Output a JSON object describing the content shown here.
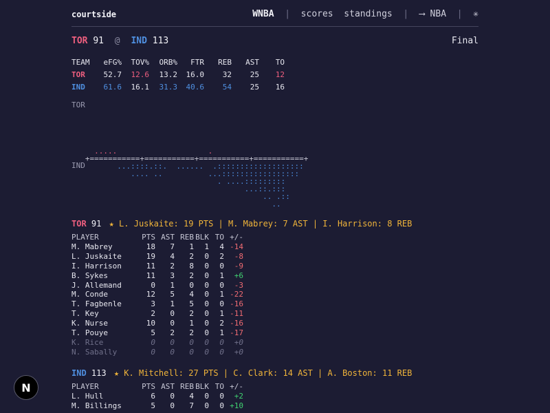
{
  "brand": "courtside",
  "nav": {
    "league": "WNBA",
    "sep": "|",
    "scores": "scores",
    "standings": "standings",
    "nba": "⟶ NBA",
    "theme_icon": "✳"
  },
  "game": {
    "away_abbr": "TOR",
    "away_score": "91",
    "at": "@",
    "home_abbr": "IND",
    "home_score": "113",
    "status": "Final"
  },
  "four_factors": {
    "headers": [
      "TEAM",
      "eFG%",
      "TOV%",
      "ORB%",
      "FTR",
      "REB",
      "AST",
      "TO"
    ],
    "rows": [
      {
        "team": "TOR",
        "values": [
          "52.7",
          "12.6",
          "13.2",
          "16.0",
          "32",
          "25",
          "12"
        ]
      },
      {
        "team": "IND",
        "values": [
          "61.6",
          "16.1",
          "31.3",
          "40.6",
          "54",
          "25",
          "16"
        ]
      }
    ]
  },
  "flow": {
    "top_label": "TOR",
    "bottom_label": "IND",
    "tor_line": "     .....                    .",
    "axis": "   +===========+===========+===========+===========+",
    "ind_lines": [
      "          ...::::.::.  ......  .:::::::::::::::::::",
      "             .... ..          ...:::::::::::::::::",
      "                                . ....:::::::::",
      "                                      ...::.:::",
      "                                          .. .::",
      "                                            .."
    ]
  },
  "box_headers": [
    "PLAYER",
    "PTS",
    "AST",
    "REB",
    "BLK",
    "TO",
    "+/-"
  ],
  "tor_box": {
    "abbr": "TOR",
    "score": "91",
    "leaders": "★ L. Juskaite: 19 PTS | M. Mabrey: 7 AST | I. Harrison: 8 REB",
    "players": [
      {
        "name": "M. Mabrey",
        "pts": "18",
        "ast": "7",
        "reb": "1",
        "blk": "1",
        "to": "4",
        "pm": "-14"
      },
      {
        "name": "L. Juskaite",
        "pts": "19",
        "ast": "4",
        "reb": "2",
        "blk": "0",
        "to": "2",
        "pm": "-8"
      },
      {
        "name": "I. Harrison",
        "pts": "11",
        "ast": "2",
        "reb": "8",
        "blk": "0",
        "to": "0",
        "pm": "-9"
      },
      {
        "name": "B. Sykes",
        "pts": "11",
        "ast": "3",
        "reb": "2",
        "blk": "0",
        "to": "1",
        "pm": "+6"
      },
      {
        "name": "J. Allemand",
        "pts": "0",
        "ast": "1",
        "reb": "0",
        "blk": "0",
        "to": "0",
        "pm": "-3"
      },
      {
        "name": "M. Conde",
        "pts": "12",
        "ast": "5",
        "reb": "4",
        "blk": "0",
        "to": "1",
        "pm": "-22"
      },
      {
        "name": "T. Fagbenle",
        "pts": "3",
        "ast": "1",
        "reb": "5",
        "blk": "0",
        "to": "0",
        "pm": "-16"
      },
      {
        "name": "T. Key",
        "pts": "2",
        "ast": "0",
        "reb": "2",
        "blk": "0",
        "to": "1",
        "pm": "-11"
      },
      {
        "name": "K. Nurse",
        "pts": "10",
        "ast": "0",
        "reb": "1",
        "blk": "0",
        "to": "2",
        "pm": "-16"
      },
      {
        "name": "T. Pouye",
        "pts": "5",
        "ast": "2",
        "reb": "2",
        "blk": "0",
        "to": "1",
        "pm": "-17"
      },
      {
        "name": "K. Rice",
        "pts": "0",
        "ast": "0",
        "reb": "0",
        "blk": "0",
        "to": "0",
        "pm": "+0",
        "dnp": true
      },
      {
        "name": "N. Sabally",
        "pts": "0",
        "ast": "0",
        "reb": "0",
        "blk": "0",
        "to": "0",
        "pm": "+0",
        "dnp": true
      }
    ]
  },
  "ind_box": {
    "abbr": "IND",
    "score": "113",
    "leaders": "★ K. Mitchell: 27 PTS | C. Clark: 14 AST | A. Boston: 11 REB",
    "players": [
      {
        "name": "L. Hull",
        "pts": "6",
        "ast": "0",
        "reb": "4",
        "blk": "0",
        "to": "0",
        "pm": "+2"
      },
      {
        "name": "M. Billings",
        "pts": "5",
        "ast": "0",
        "reb": "7",
        "blk": "0",
        "to": "0",
        "pm": "+10"
      }
    ]
  },
  "next_logo": "N",
  "colors": {
    "bg": "#1c1c33",
    "tor": "#ef5f7f",
    "ind": "#4f8fe0",
    "star": "#f0b43a",
    "plus": "#40d070",
    "minus": "#f06b72"
  }
}
